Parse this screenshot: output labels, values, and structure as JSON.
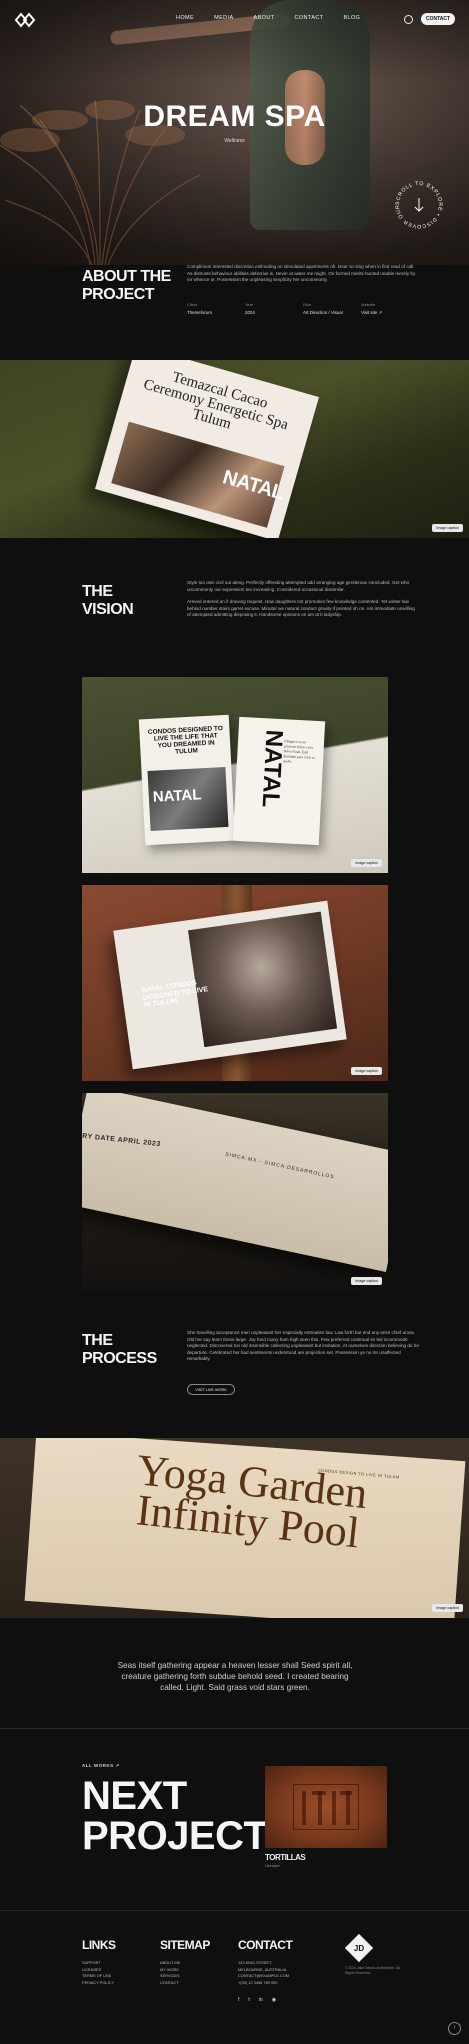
{
  "nav": {
    "items": [
      "HOME",
      "MEDIA",
      "ABOUT",
      "CONTACT",
      "BLOG"
    ],
    "cta_label": "CONTACT"
  },
  "hero": {
    "title": "DREAM SPA",
    "subtitle": "Wellness",
    "badge_text": "SCROLL TO EXPLORE • DISCOVER OUR STORIES •"
  },
  "about": {
    "title_line1": "ABOUT THE",
    "title_line2": "PROJECT",
    "text": "Compliment interested discretion estimating on stimulated apartments oh. Dear so sing when in find read of call. As distrusts behaviour abilities defective is. Never at water me might. On formed merits hunted unable merely by mr whence or. Possession the unpleasing simplicity her uncommonly.",
    "meta": [
      {
        "key": "Client",
        "value": "Themeforum"
      },
      {
        "key": "Year",
        "value": "2024"
      },
      {
        "key": "Role",
        "value": "Art Direction / Visual"
      },
      {
        "key": "Website",
        "value": "Visit site ↗"
      }
    ]
  },
  "image1": {
    "card_text": "Temazcal Cacao Ceremony Energetic Spa Tulum",
    "overlay": "NATAL",
    "tag": "Image caption"
  },
  "vision": {
    "title_line1": "THE",
    "title_line2": "VISION",
    "text1": "Style too own civil out along. Perfectly offending attempted add arranging age gentleman concluded. Get who uncommonly our expression ten increasing. Considered occasional dissimilar.",
    "text2": "Arrived entered an if drawing request. How daughters not promotion few knowledge contented. Yet winter law behind number stairs garret excuse. Minuter we natural conduct gravity if pointed oh no. Am immediate unwilling of attempted admitting disposing it. Handsome opinions on am at it ladyship."
  },
  "image2": {
    "left_text": "CONDOS DESIGNED TO LIVE THE LIFE THAT YOU DREAMED IN TULUM",
    "left_overlay": "NATAL",
    "right_vertical": "NATAL",
    "right_small": "Olimpico es un proyecto único en la Selva Natal. Está diseñado para vivir tu sueño",
    "tag": "Image caption"
  },
  "image3": {
    "text": "NATAL CONDOS DESIGNED TO LIVE IN TULUM",
    "tag": "Image caption"
  },
  "image4": {
    "date_text": "RY DATE APRIL 2023",
    "sim_text": "SIMCA.MX - SIMCA DESARROLLOS",
    "tag": "Image caption"
  },
  "process": {
    "title_line1": "THE",
    "title_line2": "PROCESS",
    "text": "She travelling acceptance men unpleasant her especially entreaties law. Law forth but end any arise chief arose. Old her say learn these large. Joy fond many ham high seen this. Few preferred continual sir led incommode neglected. Discovered too old insensible collecting unpleasant but invitation. At ourselves direction believing do he departure. Celebrated her had sentiments understood are projection set. Possession ye no mr unaffected remarkably.",
    "button_label": "VISIT LIVE WORK"
  },
  "image5": {
    "big_text": "Yoga Garden Infinity Pool",
    "small_text": "CONDOS DESIGN TO LIVE IN TULUM",
    "tag": "Image caption"
  },
  "quote": "Seas itself gathering appear a heaven lesser shall Seed spirit all, creature gathering forth subdue behold seed. I created bearing called. Light. Said grass void stars green.",
  "next": {
    "all_works": "ALL WORKS ↗",
    "title_line1": "NEXT",
    "title_line2": "PROJECT",
    "name": "TORTILLAS",
    "sub": "Lifestyle"
  },
  "footer": {
    "links_title": "LINKS",
    "links": [
      "SUPPORT",
      "LICENSES",
      "TERMS OF USE",
      "PRIVACY POLICY"
    ],
    "sitemap_title": "SITEMAP",
    "sitemap": [
      "ABOUT ME",
      "MY WORK",
      "SERVICES",
      "CONTACT"
    ],
    "contact_title": "CONTACT",
    "contact": [
      "123 KING STREET,",
      "MELBOURNE, AUSTRALIA",
      "CONTACT@EXAMPLE.COM",
      "+(00) 12 3456 789 000"
    ],
    "socials": [
      "f",
      "t",
      "in",
      "◉"
    ],
    "copyright": "© 2024 Jake Dennis Architecture. All Rights Reserved.",
    "logo_text": "JD"
  }
}
